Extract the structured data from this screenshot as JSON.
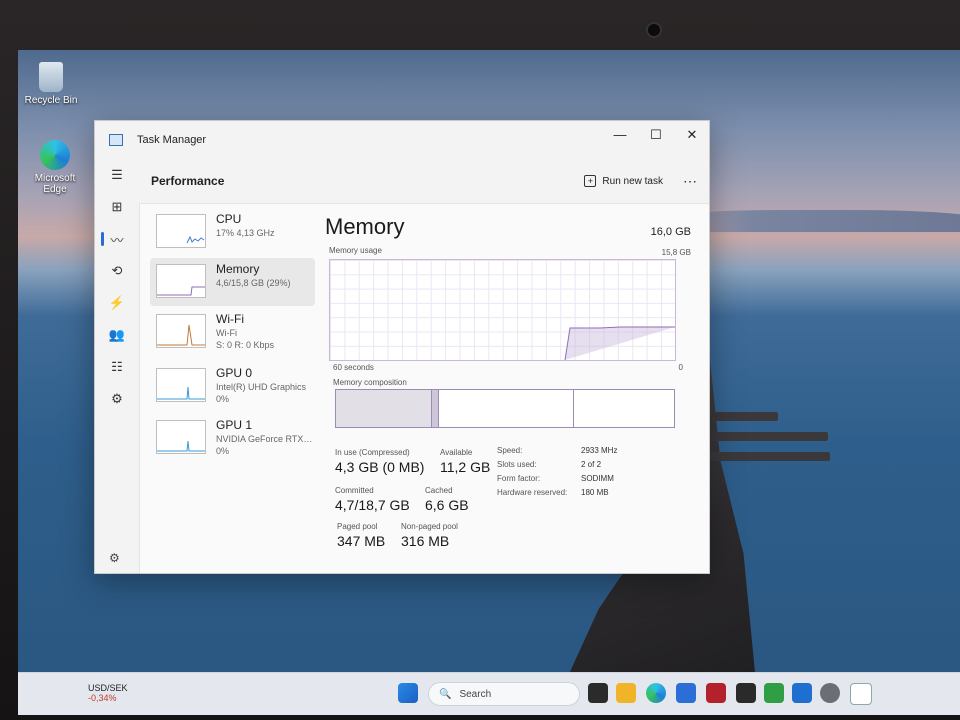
{
  "desktop": {
    "icons": [
      {
        "label": "Recycle Bin"
      },
      {
        "label": "Microsoft Edge"
      }
    ]
  },
  "window": {
    "title": "Task Manager",
    "controls": {
      "minimize": "—",
      "maximize": "☐",
      "close": "✕"
    },
    "header": {
      "title": "Performance",
      "run_new_task": "Run new task",
      "more": "⋯"
    }
  },
  "nav": [
    "☰",
    "⊞",
    "〰",
    "⟲",
    "⚡",
    "👥",
    "☷",
    "⚙"
  ],
  "perf_list": [
    {
      "name": "CPU",
      "sub1": "17% 4,13 GHz",
      "sub2": ""
    },
    {
      "name": "Memory",
      "sub1": "4,6/15,8 GB (29%)",
      "sub2": ""
    },
    {
      "name": "Wi-Fi",
      "sub1": "Wi-Fi",
      "sub2": "S: 0 R: 0 Kbps"
    },
    {
      "name": "GPU 0",
      "sub1": "Intel(R) UHD Graphics",
      "sub2": "0%"
    },
    {
      "name": "GPU 1",
      "sub1": "NVIDIA GeForce RTX…",
      "sub2": "0%"
    }
  ],
  "memory": {
    "title": "Memory",
    "total": "16,0 GB",
    "usage_label": "Memory usage",
    "usage_max": "15,8 GB",
    "time_left": "60 seconds",
    "time_right": "0",
    "composition_label": "Memory composition",
    "usage_percent": 29,
    "stats": {
      "in_use": {
        "label": "In use (Compressed)",
        "value": "4,3 GB (0 MB)"
      },
      "available": {
        "label": "Available",
        "value": "11,2 GB"
      },
      "committed": {
        "label": "Committed",
        "value": "4,7/18,7 GB"
      },
      "cached": {
        "label": "Cached",
        "value": "6,6 GB"
      },
      "paged_pool": {
        "label": "Paged pool",
        "value": "347 MB"
      },
      "non_paged_pool": {
        "label": "Non-paged pool",
        "value": "316 MB"
      }
    },
    "details": [
      {
        "k": "Speed:",
        "v": "2933 MHz"
      },
      {
        "k": "Slots used:",
        "v": "2 of 2"
      },
      {
        "k": "Form factor:",
        "v": "SODIMM"
      },
      {
        "k": "Hardware reserved:",
        "v": "180 MB"
      }
    ]
  },
  "taskbar": {
    "ticker": {
      "symbol": "USD/SEK",
      "change": "-0,34%"
    },
    "search_placeholder": "Search"
  }
}
